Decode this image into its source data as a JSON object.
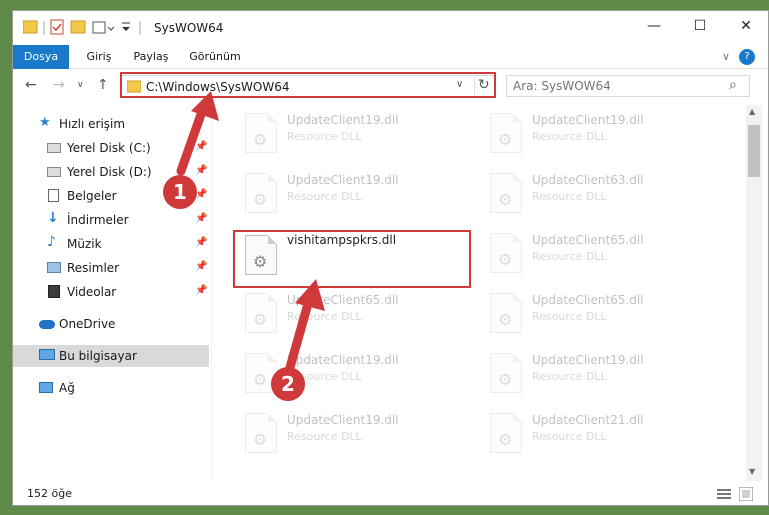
{
  "window": {
    "title": "SysWOW64",
    "controls": {
      "minimize": "—",
      "maximize": "☐",
      "close": "✕"
    }
  },
  "ribbon": {
    "tabs": [
      "Dosya",
      "Giriş",
      "Paylaş",
      "Görünüm"
    ],
    "expand_icon": "∨",
    "help_icon": "?"
  },
  "nav": {
    "back": "←",
    "forward": "→",
    "recent": "∨",
    "up": "↑",
    "address": "C:\\Windows\\SysWOW64",
    "refresh": "↻",
    "dropdown": "∨",
    "search_placeholder": "Ara: SysWOW64",
    "search_icon": "⌕"
  },
  "sidebar": {
    "items": [
      {
        "label": "Hızlı erişim",
        "icon": "star-icon",
        "pinned": false
      },
      {
        "label": "Yerel Disk (C:)",
        "icon": "drive-icon",
        "pinned": true
      },
      {
        "label": "Yerel Disk (D:)",
        "icon": "drive-icon",
        "pinned": true
      },
      {
        "label": "Belgeler",
        "icon": "document-icon",
        "pinned": true
      },
      {
        "label": "İndirmeler",
        "icon": "download-icon",
        "pinned": true
      },
      {
        "label": "Müzik",
        "icon": "music-icon",
        "pinned": true
      },
      {
        "label": "Resimler",
        "icon": "pictures-icon",
        "pinned": true
      },
      {
        "label": "Videolar",
        "icon": "video-icon",
        "pinned": true
      },
      {
        "label": "OneDrive",
        "icon": "cloud-icon",
        "pinned": false
      },
      {
        "label": "Bu bilgisayar",
        "icon": "computer-icon",
        "pinned": false
      },
      {
        "label": "Ağ",
        "icon": "network-icon",
        "pinned": false
      }
    ],
    "pin_glyph": "📌"
  },
  "files": [
    {
      "name": "UpdateClient19.dll",
      "type": "Resource DLL"
    },
    {
      "name": "UpdateClient19.dll",
      "type": "Resource DLL"
    },
    {
      "name": "UpdateClient19.dll",
      "type": "Resource DLL"
    },
    {
      "name": "UpdateClient63.dll",
      "type": "Resource DLL"
    },
    {
      "name": "vishitampspkrs.dll",
      "type": ""
    },
    {
      "name": "UpdateClient65.dll",
      "type": "Resource DLL"
    },
    {
      "name": "UpdateClient65.dll",
      "type": "Resource DLL"
    },
    {
      "name": "UpdateClient65.dll",
      "type": "Resource DLL"
    },
    {
      "name": "UpdateClient19.dll",
      "type": "Resource DLL"
    },
    {
      "name": "UpdateClient19.dll",
      "type": "Resource DLL"
    },
    {
      "name": "UpdateClient19.dll",
      "type": "Resource DLL"
    },
    {
      "name": "UpdateClient21.dll",
      "type": "Resource DLL"
    }
  ],
  "status": {
    "count": "152 öğe"
  },
  "annotations": {
    "step1": "1",
    "step2": "2",
    "color": "#d0393a"
  }
}
